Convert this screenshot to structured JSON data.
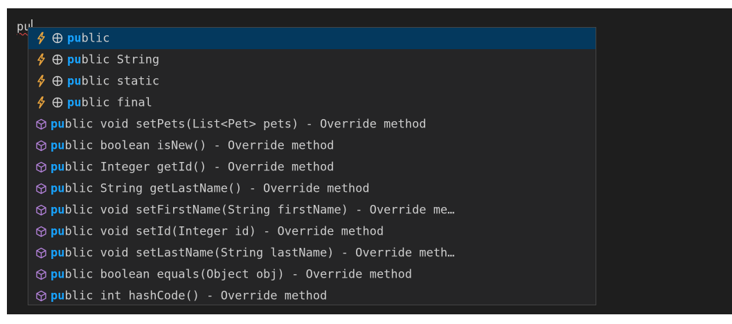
{
  "editor": {
    "typed_text": "pu"
  },
  "colors": {
    "background": "#1e1e1e",
    "widget_background": "#252526",
    "selected_row": "#04395e",
    "match_highlight": "#18a3ff",
    "snippet_icon": "#e8a33d",
    "method_icon": "#b180d7"
  },
  "suggestions": [
    {
      "icon": "lightning-icon",
      "secondary_icon": "globe-icon",
      "match": "pu",
      "rest": "blic"
    },
    {
      "icon": "lightning-icon",
      "secondary_icon": "globe-icon",
      "match": "pu",
      "rest": "blic String"
    },
    {
      "icon": "lightning-icon",
      "secondary_icon": "globe-icon",
      "match": "pu",
      "rest": "blic static"
    },
    {
      "icon": "lightning-icon",
      "secondary_icon": "globe-icon",
      "match": "pu",
      "rest": "blic final"
    },
    {
      "icon": "cube-icon",
      "match": "pu",
      "rest": "blic void setPets(List<Pet> pets) - Override method"
    },
    {
      "icon": "cube-icon",
      "match": "pu",
      "rest": "blic boolean isNew() - Override method"
    },
    {
      "icon": "cube-icon",
      "match": "pu",
      "rest": "blic Integer getId() - Override method"
    },
    {
      "icon": "cube-icon",
      "match": "pu",
      "rest": "blic String getLastName() - Override method"
    },
    {
      "icon": "cube-icon",
      "match": "pu",
      "rest": "blic void setFirstName(String firstName) - Override me…"
    },
    {
      "icon": "cube-icon",
      "match": "pu",
      "rest": "blic void setId(Integer id) - Override method"
    },
    {
      "icon": "cube-icon",
      "match": "pu",
      "rest": "blic void setLastName(String lastName) - Override meth…"
    },
    {
      "icon": "cube-icon",
      "match": "pu",
      "rest": "blic boolean equals(Object obj) - Override method"
    },
    {
      "icon": "cube-icon",
      "match": "pu",
      "rest": "blic int hashCode() - Override method"
    }
  ]
}
